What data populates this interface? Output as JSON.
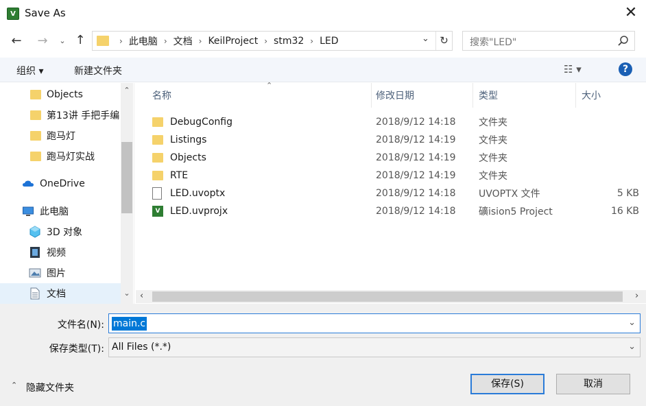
{
  "window": {
    "title": "Save As",
    "app_icon_letter": "V"
  },
  "nav": {
    "breadcrumb": [
      "此电脑",
      "文档",
      "KeilProject",
      "stm32",
      "LED"
    ],
    "search_placeholder": "搜索\"LED\""
  },
  "toolbar": {
    "organize": "组织 ▾",
    "new_folder": "新建文件夹"
  },
  "sidebar": {
    "items": [
      {
        "label": "Objects",
        "icon": "folder-icon"
      },
      {
        "label": "第13讲 手把手编",
        "icon": "folder-icon"
      },
      {
        "label": "跑马灯",
        "icon": "folder-icon"
      },
      {
        "label": "跑马灯实战",
        "icon": "folder-icon"
      },
      {
        "label": "OneDrive",
        "icon": "cloud-icon"
      },
      {
        "label": "此电脑",
        "icon": "computer-icon"
      },
      {
        "label": "3D 对象",
        "icon": "cube-icon"
      },
      {
        "label": "视频",
        "icon": "video-icon"
      },
      {
        "label": "图片",
        "icon": "picture-icon"
      },
      {
        "label": "文档",
        "icon": "document-icon"
      }
    ]
  },
  "columns": {
    "name": "名称",
    "date": "修改日期",
    "type": "类型",
    "size": "大小"
  },
  "files": [
    {
      "name": "DebugConfig",
      "date": "2018/9/12 14:18",
      "type": "文件夹",
      "size": "",
      "icon": "folder-icon"
    },
    {
      "name": "Listings",
      "date": "2018/9/12 14:19",
      "type": "文件夹",
      "size": "",
      "icon": "folder-icon"
    },
    {
      "name": "Objects",
      "date": "2018/9/12 14:19",
      "type": "文件夹",
      "size": "",
      "icon": "folder-icon"
    },
    {
      "name": "RTE",
      "date": "2018/9/12 14:19",
      "type": "文件夹",
      "size": "",
      "icon": "folder-icon"
    },
    {
      "name": "LED.uvoptx",
      "date": "2018/9/12 14:18",
      "type": "UVOPTX 文件",
      "size": "5 KB",
      "icon": "file-icon"
    },
    {
      "name": "LED.uvprojx",
      "date": "2018/9/12 14:18",
      "type": "礦ision5 Project",
      "size": "16 KB",
      "icon": "keil-project-icon"
    }
  ],
  "form": {
    "filename_label": "文件名(N):",
    "filename_value": "main.c",
    "filetype_label": "保存类型(T):",
    "filetype_value": "All Files (*.*)"
  },
  "footer": {
    "hide_folders": "隐藏文件夹",
    "save": "保存(S)",
    "cancel": "取消"
  }
}
